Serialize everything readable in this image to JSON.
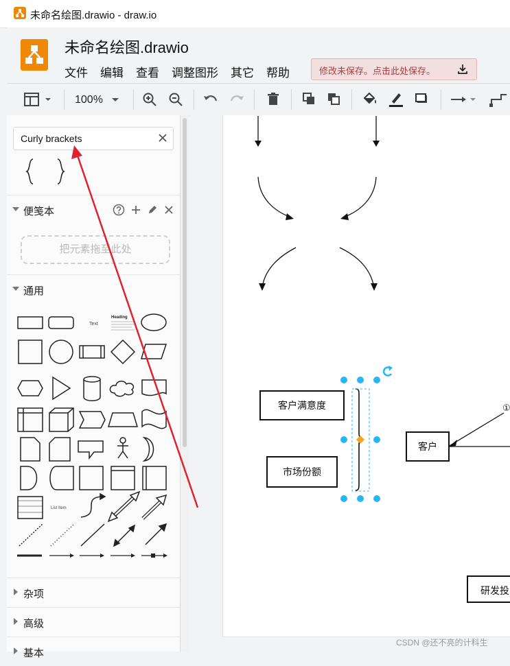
{
  "window": {
    "title": "未命名绘图.drawio - draw.io"
  },
  "header": {
    "doc_title": "未命名绘图.drawio",
    "menu": [
      "文件",
      "编辑",
      "查看",
      "调整图形",
      "其它",
      "帮助"
    ],
    "save_notice": "修改未保存。点击此处保存。"
  },
  "toolbar": {
    "zoom": "100%"
  },
  "sidebar": {
    "search": {
      "value": "Curly brackets"
    },
    "scratchpad": {
      "label": "便笺本",
      "dropzone": "把元素拖至此处"
    },
    "general": {
      "label": "通用"
    },
    "shape_text": {
      "text": "Text",
      "heading": "Heading",
      "list_item": "List Item"
    },
    "misc": {
      "label": "杂项"
    },
    "advanced": {
      "label": "高级"
    },
    "basic": {
      "label": "基本"
    }
  },
  "canvas": {
    "boxes": {
      "satisfaction": "客户满意度",
      "market_share": "市场份额",
      "customer": "客户",
      "rd": "研发投"
    },
    "circled_label": "①"
  },
  "watermark": "CSDN @还不亮的计科生",
  "colors": {
    "accent": "#f08705",
    "selection": "#29b6f2",
    "arrow_annotation": "#e0212e"
  }
}
